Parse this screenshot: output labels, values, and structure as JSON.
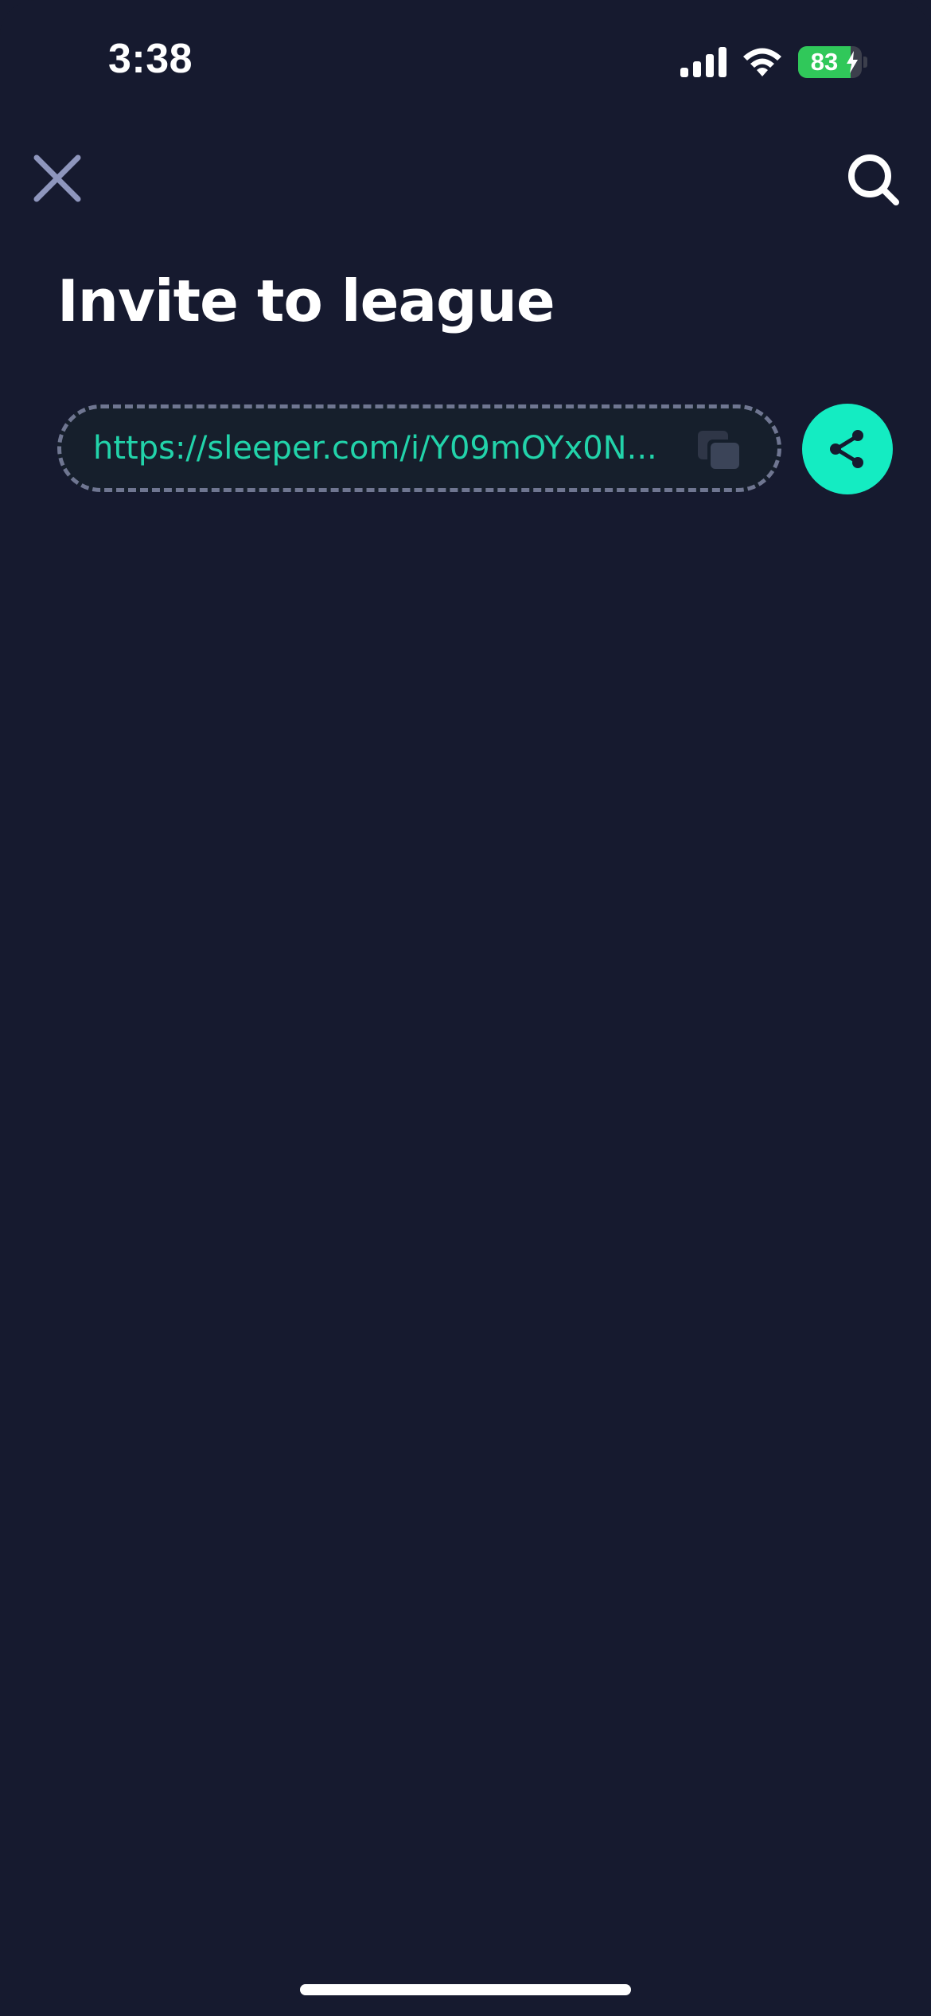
{
  "status_bar": {
    "time": "3:38",
    "battery_level": "83",
    "battery_fraction": 0.83,
    "battery_color": "#30c85a",
    "icons": [
      "signal-icon",
      "wifi-icon",
      "battery-icon",
      "charging-bolt-icon"
    ]
  },
  "nav": {
    "close_icon": "close-icon",
    "search_icon": "search-icon"
  },
  "page": {
    "title": "Invite to league"
  },
  "invite": {
    "link": "https://sleeper.com/i/Y09mOYx0N...",
    "copy_icon": "copy-icon",
    "share_icon": "share-icon"
  },
  "colors": {
    "background": "#161a2f",
    "accent": "#14ecc2",
    "link_text": "#22d3aa",
    "dashed_border": "#6f7691",
    "close_icon": "#8e96bd"
  }
}
